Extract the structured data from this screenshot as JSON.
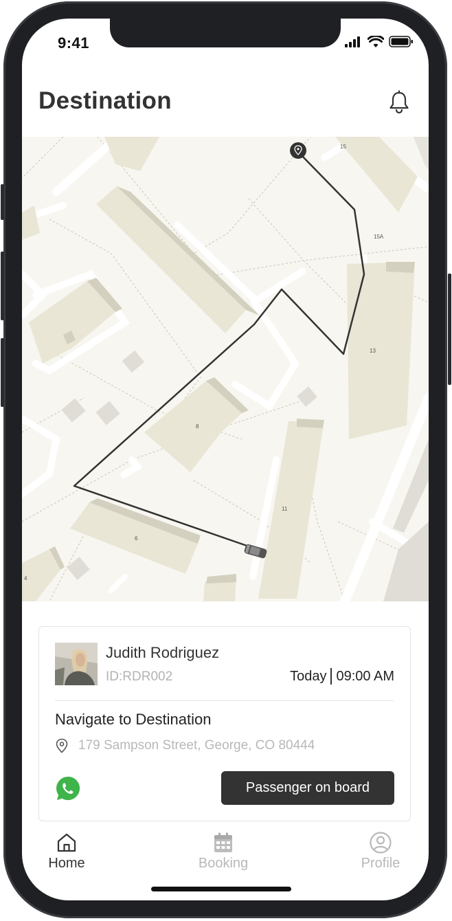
{
  "status_bar": {
    "time": "9:41"
  },
  "header": {
    "title": "Destination",
    "bell_icon": "bell-icon"
  },
  "map": {
    "labels": [
      "15",
      "15A",
      "13",
      "8",
      "11",
      "6",
      "4"
    ],
    "route_color": "#333333",
    "destination_icon": "location-pin-icon",
    "vehicle_icon": "car-icon"
  },
  "ride": {
    "passenger_name": "Judith Rodriguez",
    "passenger_id": "ID:RDR002",
    "date": "Today",
    "time": "09:00 AM",
    "task_title": "Navigate to Destination",
    "address": "179 Sampson Street, George, CO 80444",
    "action_label": "Passenger on board",
    "whatsapp_color": "#3fb44b"
  },
  "tabs": [
    {
      "label": "Home",
      "icon": "home-icon",
      "active": true
    },
    {
      "label": "Booking",
      "icon": "calendar-icon",
      "active": false
    },
    {
      "label": "Profile",
      "icon": "user-icon",
      "active": false
    }
  ],
  "colors": {
    "active_tab": "#333333",
    "inactive_tab": "#b8b8b8",
    "map_bg": "#f8f6f0",
    "building": "#ebe8d9"
  }
}
